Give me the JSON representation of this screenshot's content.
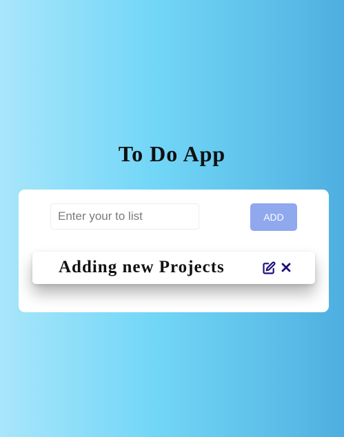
{
  "app": {
    "title": "To Do App"
  },
  "form": {
    "input_placeholder": "Enter your to list",
    "input_value": "",
    "add_label": "ADD"
  },
  "todos": [
    {
      "text": "Adding new Projects",
      "edit_icon": "edit-icon",
      "delete_icon": "close-icon"
    }
  ],
  "colors": {
    "add_button": "#8fa8ee",
    "icon": "#1a0f7a"
  }
}
